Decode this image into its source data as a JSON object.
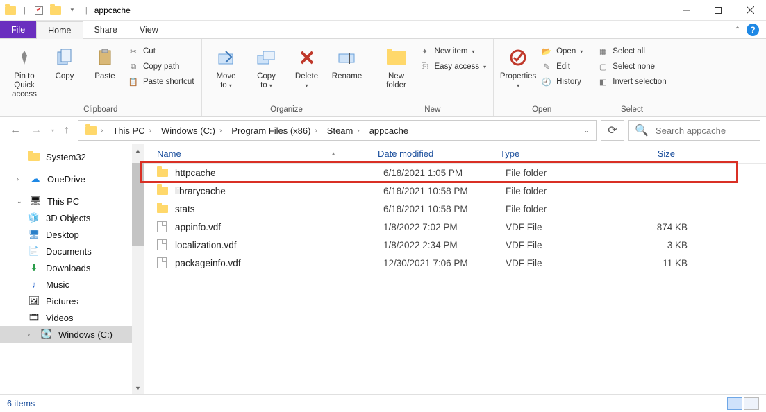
{
  "titlebar": {
    "title": "appcache"
  },
  "menu": {
    "file": "File",
    "home": "Home",
    "share": "Share",
    "view": "View"
  },
  "ribbon": {
    "clipboard": {
      "label": "Clipboard",
      "pin": "Pin to Quick\naccess",
      "copy": "Copy",
      "paste": "Paste",
      "cut": "Cut",
      "copy_path": "Copy path",
      "paste_shortcut": "Paste shortcut"
    },
    "organize": {
      "label": "Organize",
      "move_to": "Move\nto",
      "copy_to": "Copy\nto",
      "delete": "Delete",
      "rename": "Rename"
    },
    "new": {
      "label": "New",
      "new_folder": "New\nfolder",
      "new_item": "New item",
      "easy_access": "Easy access"
    },
    "open": {
      "label": "Open",
      "properties": "Properties",
      "open": "Open",
      "edit": "Edit",
      "history": "History"
    },
    "select": {
      "label": "Select",
      "select_all": "Select all",
      "select_none": "Select none",
      "invert": "Invert selection"
    }
  },
  "breadcrumbs": [
    "This PC",
    "Windows (C:)",
    "Program Files (x86)",
    "Steam",
    "appcache"
  ],
  "search": {
    "placeholder": "Search appcache"
  },
  "sidebar": {
    "system32": "System32",
    "onedrive": "OneDrive",
    "thispc": "This PC",
    "objects3d": "3D Objects",
    "desktop": "Desktop",
    "documents": "Documents",
    "downloads": "Downloads",
    "music": "Music",
    "pictures": "Pictures",
    "videos": "Videos",
    "windowsc": "Windows (C:)"
  },
  "columns": {
    "name": "Name",
    "date": "Date modified",
    "type": "Type",
    "size": "Size"
  },
  "files": [
    {
      "name": "httpcache",
      "date": "6/18/2021 1:05 PM",
      "type": "File folder",
      "size": "",
      "kind": "folder",
      "hl": true
    },
    {
      "name": "librarycache",
      "date": "6/18/2021 10:58 PM",
      "type": "File folder",
      "size": "",
      "kind": "folder"
    },
    {
      "name": "stats",
      "date": "6/18/2021 10:58 PM",
      "type": "File folder",
      "size": "",
      "kind": "folder"
    },
    {
      "name": "appinfo.vdf",
      "date": "1/8/2022 7:02 PM",
      "type": "VDF File",
      "size": "874 KB",
      "kind": "file"
    },
    {
      "name": "localization.vdf",
      "date": "1/8/2022 2:34 PM",
      "type": "VDF File",
      "size": "3 KB",
      "kind": "file"
    },
    {
      "name": "packageinfo.vdf",
      "date": "12/30/2021 7:06 PM",
      "type": "VDF File",
      "size": "11 KB",
      "kind": "file"
    }
  ],
  "status": {
    "count": "6 items"
  }
}
